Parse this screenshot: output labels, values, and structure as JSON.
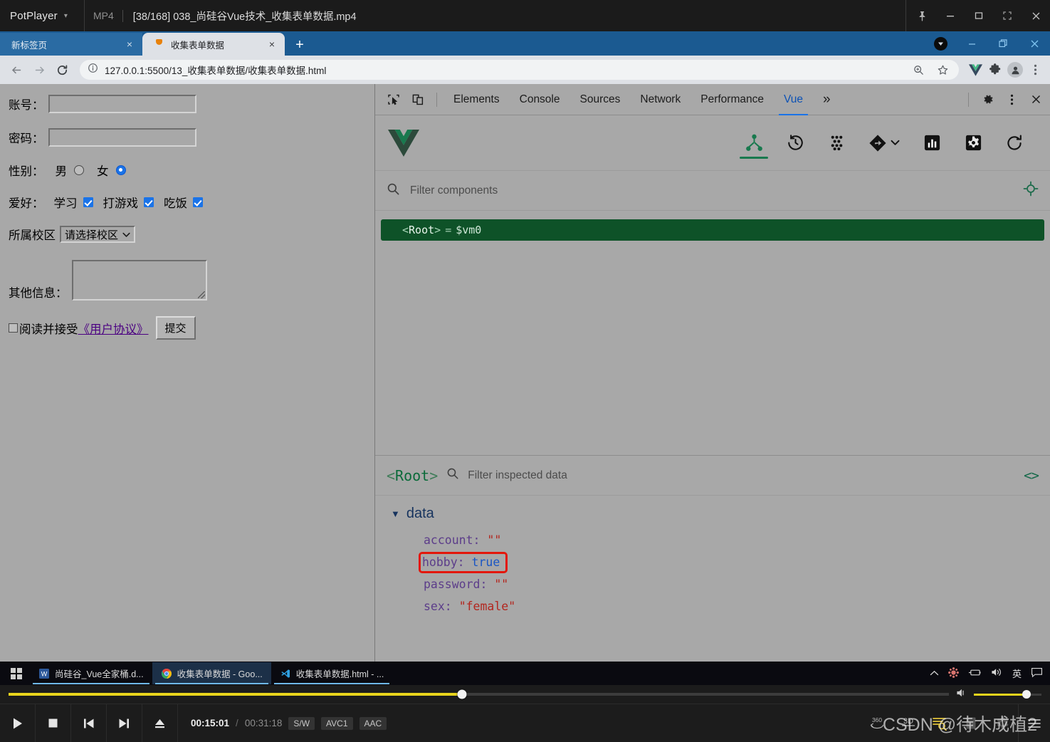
{
  "potplayer": {
    "app_name": "PotPlayer",
    "format": "MP4",
    "title": "[38/168] 038_尚硅谷Vue技术_收集表单数据.mp4",
    "window_controls": [
      "pin-icon",
      "minimize-icon",
      "maximize-icon",
      "fullscreen-icon",
      "close-icon"
    ],
    "controls": {
      "play": "play-icon",
      "stop": "stop-icon",
      "prev": "previous-icon",
      "next": "next-icon",
      "eject": "eject-icon",
      "current_time": "00:15:01",
      "slash": "/",
      "total_time": "00:31:18",
      "chips": [
        "S/W",
        "AVC1",
        "AAC"
      ],
      "right_buttons": [
        "360",
        "3D",
        "playlist-icon",
        "bookmark-icon",
        "settings-icon",
        "menu-icon"
      ],
      "seek_percent": 48.2,
      "volume_percent": 78
    },
    "watermark": "CSDN @待木成植2"
  },
  "chrome": {
    "tabs": [
      {
        "title": "新标签页",
        "active": false,
        "favicon": "none",
        "close": "×"
      },
      {
        "title": "收集表单数据",
        "active": true,
        "favicon": "vue-favicon",
        "close": "×"
      }
    ],
    "new_tab": "+",
    "window_controls": [
      "profile-badge-icon",
      "minimize-icon",
      "restore-icon",
      "close-icon"
    ],
    "toolbar": {
      "back": "back-arrow-icon",
      "forward": "forward-arrow-icon",
      "reload": "reload-icon",
      "site_info": "info-circle-icon",
      "url": "127.0.0.1:5500/13_收集表单数据/收集表单数据.html",
      "right_icons": [
        "zoom-icon",
        "bookmark-star-icon",
        "vue-extension-icon",
        "extensions-puzzle-icon",
        "profile-avatar-icon",
        "chrome-menu-icon"
      ]
    }
  },
  "form": {
    "account": {
      "label": "账号：",
      "value": "",
      "placeholder": ""
    },
    "password": {
      "label": "密码：",
      "value": "",
      "placeholder": ""
    },
    "sex": {
      "label": "性别：",
      "options": [
        {
          "label": "男",
          "checked": false
        },
        {
          "label": "女",
          "checked": true
        }
      ]
    },
    "hobby": {
      "label": "爱好：",
      "options": [
        {
          "label": "学习",
          "checked": true
        },
        {
          "label": "打游戏",
          "checked": true
        },
        {
          "label": "吃饭",
          "checked": true
        }
      ]
    },
    "campus": {
      "label": "所属校区",
      "selected": "请选择校区",
      "caret": "⌄"
    },
    "other": {
      "label": "其他信息：",
      "value": ""
    },
    "agreement": {
      "checked": false,
      "prefix": "阅读并接受",
      "link": "《用户协议》"
    },
    "submit_label": "提交"
  },
  "devtools": {
    "left_icons": [
      "inspect-element-icon",
      "device-toolbar-icon"
    ],
    "tabs": [
      {
        "label": "Elements",
        "selected": false
      },
      {
        "label": "Console",
        "selected": false
      },
      {
        "label": "Sources",
        "selected": false
      },
      {
        "label": "Network",
        "selected": false
      },
      {
        "label": "Performance",
        "selected": false
      },
      {
        "label": "Vue",
        "selected": true
      }
    ],
    "more_tabs": "»",
    "right_icons": [
      "settings-gear-icon",
      "devtools-more-icon",
      "devtools-close-icon"
    ],
    "vue": {
      "logo": "vue-logo-icon",
      "toolbar_icons": [
        {
          "name": "component-tree-icon",
          "active": true
        },
        {
          "name": "timeline-history-icon",
          "active": false
        },
        {
          "name": "vuex-dots-icon",
          "active": false
        },
        {
          "name": "router-diamond-icon",
          "active": false
        },
        {
          "name": "performance-bars-icon",
          "active": false
        },
        {
          "name": "settings-icon",
          "active": false
        },
        {
          "name": "refresh-icon",
          "active": false
        }
      ],
      "router_caret": "⌄",
      "filter": {
        "icon": "search-icon",
        "placeholder": "Filter components"
      },
      "select_target_icon": "target-crosshair-icon",
      "tree": [
        {
          "open": "<",
          "name": "Root",
          "close": ">",
          "eq": "=",
          "instance": "$vm0",
          "selected": true
        }
      ],
      "inspector": {
        "root_open": "<",
        "root_name": "Root",
        "root_close": ">",
        "search_icon": "search-icon",
        "filter_placeholder": "Filter inspected data",
        "code_icon": "<>",
        "section": {
          "triangle": "▼",
          "title": "data"
        },
        "entries": [
          {
            "key": "account:",
            "value": "\"\"",
            "type": "string",
            "highlighted": false
          },
          {
            "key": "hobby:",
            "value": "true",
            "type": "boolean",
            "highlighted": true
          },
          {
            "key": "password:",
            "value": "\"\"",
            "type": "string",
            "highlighted": false
          },
          {
            "key": "sex:",
            "value": "\"female\"",
            "type": "string",
            "highlighted": false
          }
        ]
      }
    }
  },
  "taskbar": {
    "start": "windows-start-icon",
    "items": [
      {
        "label": "尚硅谷_Vue全家桶.d...",
        "icon": "word-icon",
        "active": false
      },
      {
        "label": "收集表单数据 - Goo...",
        "icon": "chrome-icon",
        "active": true
      },
      {
        "label": "收集表单数据.html - ...",
        "icon": "vscode-icon",
        "active": false
      }
    ],
    "tray": [
      "chevron-up-icon",
      "app-tray-icon",
      "battery-icon",
      "volume-icon",
      "英",
      "notifications-icon"
    ]
  },
  "colors": {
    "vue_green": "#18794e",
    "tree_selected_bg": "#0e5228",
    "highlight_red": "#e3170a",
    "devtools_bg": "#a8a8a8",
    "chrome_tab_active": "#dee1e6",
    "chrome_tabstrip": "#1b5a91",
    "potplayer_bg": "#1c1c1c",
    "seek_yellow": "#e8d41c"
  }
}
